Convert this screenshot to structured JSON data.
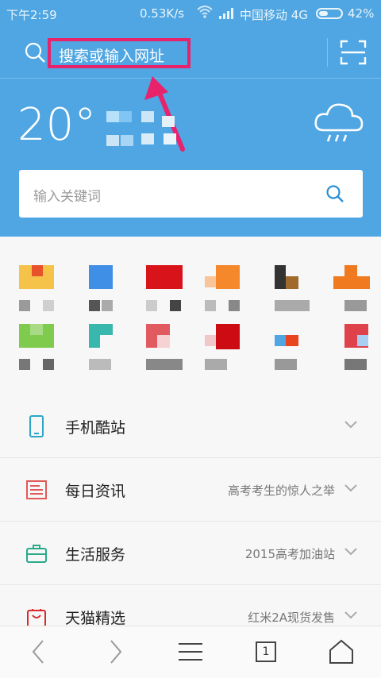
{
  "status_bar": {
    "time": "下午2:59",
    "speed": "0.53K/s",
    "carrier": "中国移动 4G",
    "battery": "42%",
    "battery_level": 0.42
  },
  "top_bar": {
    "url_placeholder": "搜索或输入网址"
  },
  "weather": {
    "temperature": "20°",
    "icon": "cloud-rain-icon"
  },
  "keyword_search": {
    "placeholder": "输入关键词"
  },
  "list": [
    {
      "title": "手机酷站",
      "subtitle": "",
      "icon": "phone-icon",
      "color": "#2ba6c8"
    },
    {
      "title": "每日资讯",
      "subtitle": "高考考生的惊人之举",
      "icon": "news-icon",
      "color": "#e05a5a"
    },
    {
      "title": "生活服务",
      "subtitle": "2015高考加油站",
      "icon": "briefcase-icon",
      "color": "#2aaa8a"
    },
    {
      "title": "天猫精选",
      "subtitle": "红米2A现货发售",
      "icon": "shopping-bag-icon",
      "color": "#d92b2b"
    }
  ],
  "bottom_bar": {
    "tab_count": "1"
  },
  "colors": {
    "header": "#4fa6e2",
    "highlight": "#e8226b"
  }
}
